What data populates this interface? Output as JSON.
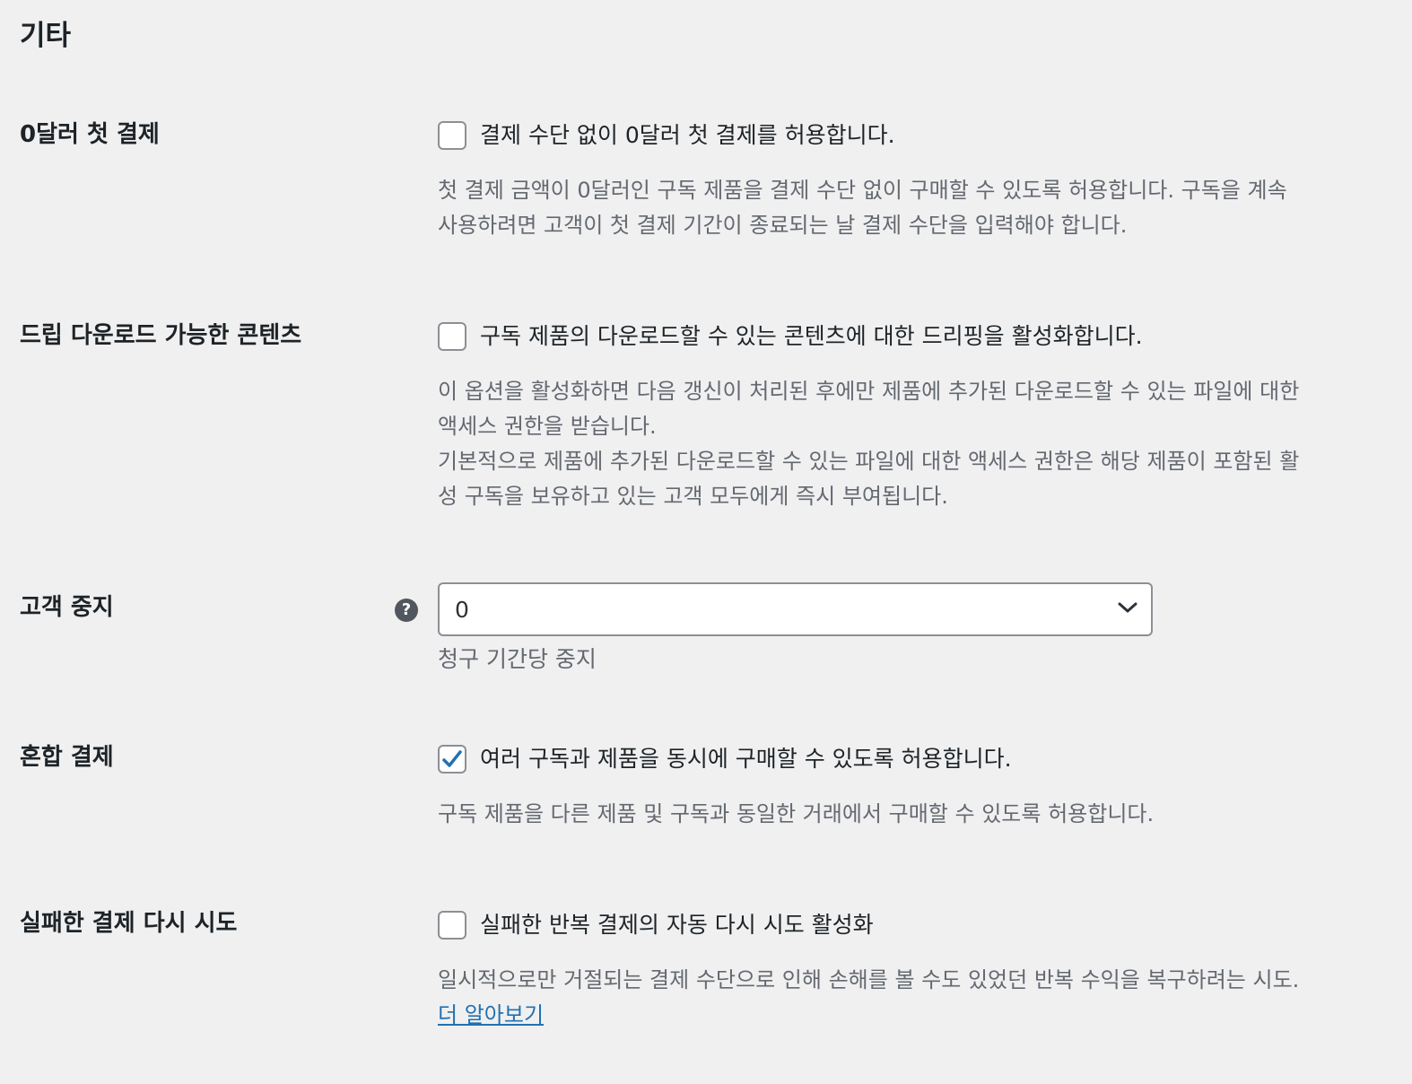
{
  "section_title": "기타",
  "zero_initial": {
    "label": "0달러 첫 결제",
    "checkbox_label": "결제 수단 없이 0달러 첫 결제를 허용합니다.",
    "checked": false,
    "desc_lines": [
      "첫 결제 금액이 0달러인 구독 제품을 결제 수단 없이 구매할 수 있도록 허용합니다. 구독을 계속",
      "사용하려면 고객이 첫 결제 기간이 종료되는 날 결제 수단을 입력해야 합니다."
    ]
  },
  "drip": {
    "label": "드립 다운로드 가능한 콘텐츠",
    "checkbox_label": "구독 제품의 다운로드할 수 있는 콘텐츠에 대한 드리핑을 활성화합니다.",
    "checked": false,
    "desc_lines": [
      "이 옵션을 활성화하면 다음 갱신이 처리된 후에만 제품에 추가된 다운로드할 수 있는 파일에 대한",
      "액세스 권한을 받습니다.",
      "기본적으로 제품에 추가된 다운로드할 수 있는 파일에 대한 액세스 권한은 해당 제품이 포함된 활",
      "성 구독을 보유하고 있는 고객 모두에게 즉시 부여됩니다."
    ]
  },
  "suspension": {
    "label": "고객 중지",
    "help_icon": "?",
    "select_value": "0",
    "desc": "청구 기간당 중지"
  },
  "mixed": {
    "label": "혼합 결제",
    "checkbox_label": "여러 구독과 제품을 동시에 구매할 수 있도록 허용합니다.",
    "checked": true,
    "desc_lines": [
      "구독 제품을 다른 제품 및 구독과 동일한 거래에서 구매할 수 있도록 허용합니다."
    ]
  },
  "retry": {
    "label": "실패한 결제 다시 시도",
    "checkbox_label": "실패한 반복 결제의 자동 다시 시도 활성화",
    "checked": false,
    "desc_lines": [
      "일시적으로만 거절되는 결제 수단으로 인해 손해를 볼 수도 있었던 반복 수익을 복구하려는 시도."
    ],
    "link_text": "더 알아보기"
  },
  "colors": {
    "background": "#f0f0f1",
    "accent": "#2271b1",
    "text": "#1d2327",
    "muted": "#646970"
  }
}
